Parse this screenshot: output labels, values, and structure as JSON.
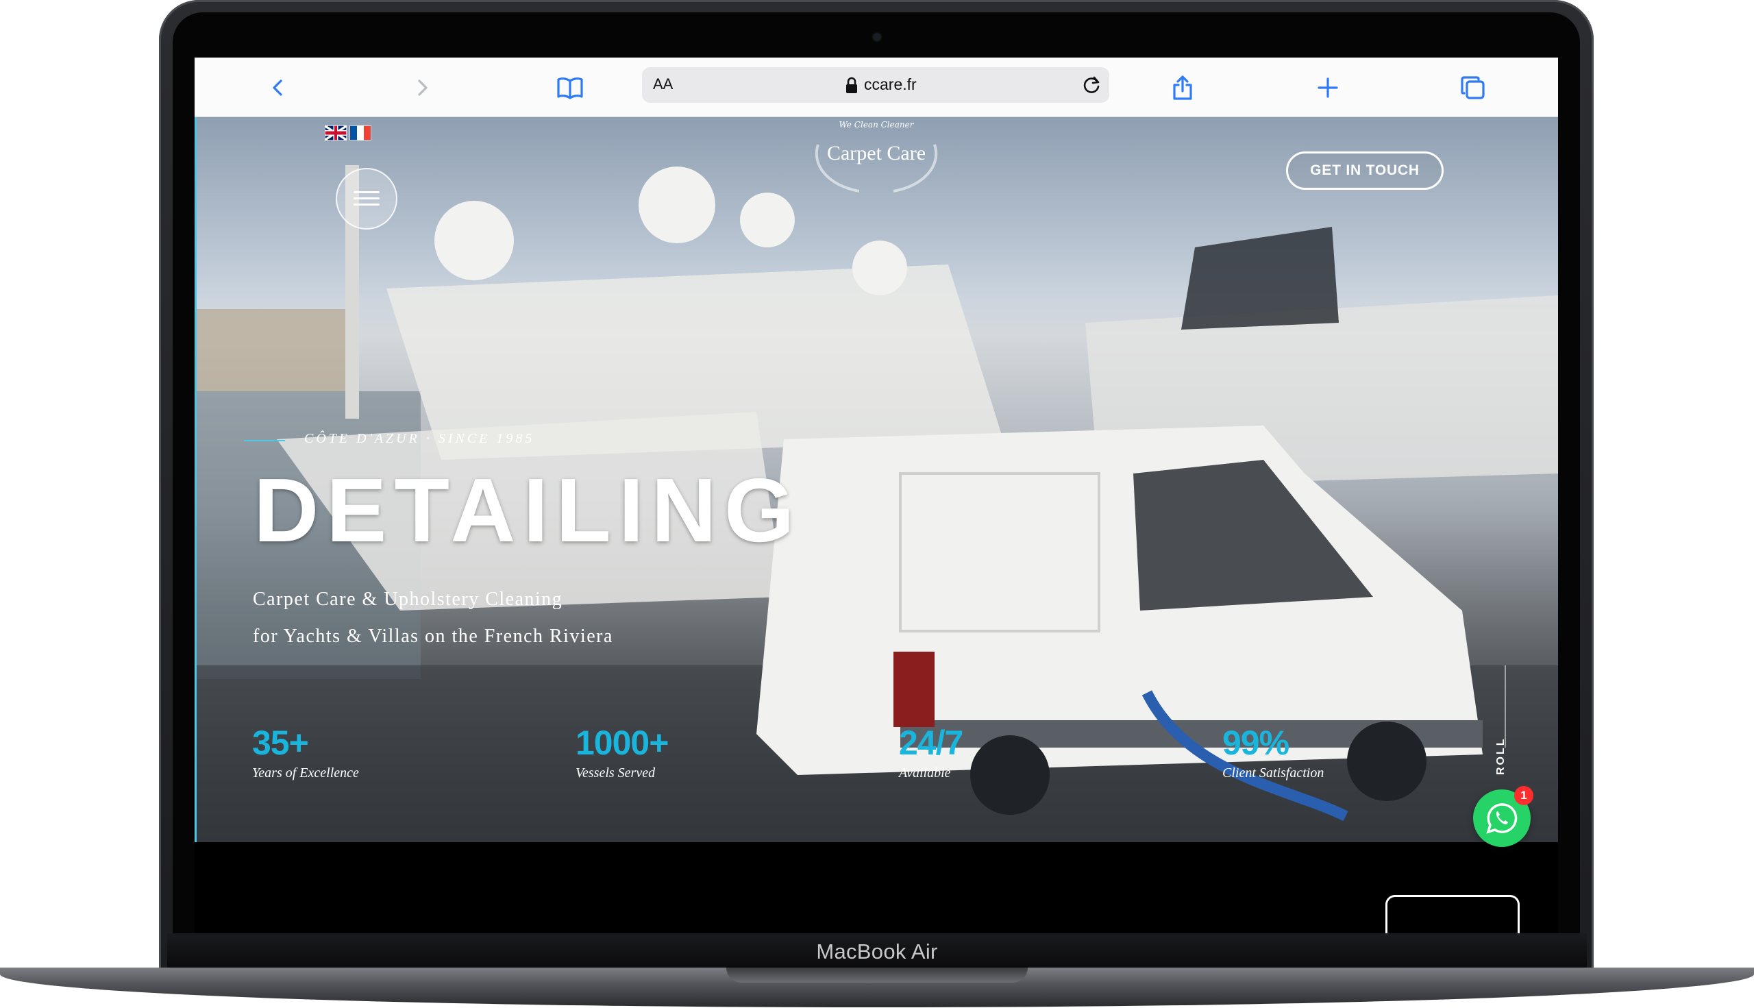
{
  "device": {
    "label": "MacBook Air"
  },
  "browser": {
    "url_aa": "AA",
    "url": "ccare.fr",
    "icons": [
      "back-icon",
      "forward-icon",
      "bookmarks-icon",
      "lock-icon",
      "reload-icon",
      "share-icon",
      "new-tab-icon",
      "tabs-icon"
    ]
  },
  "site": {
    "brand_tag": "We Clean Cleaner",
    "brand_name": "Carpet Care",
    "cta_label": "GET IN TOUCH",
    "languages": [
      "English",
      "Français"
    ],
    "eyebrow": "CÔTE D'AZUR · SINCE 1985",
    "headline": "DETAILING",
    "sub_line_1": "Carpet Care & Upholstery Cleaning",
    "sub_line_2": "for Yachts & Villas on the French Riviera",
    "stats": [
      {
        "value": "35+",
        "label": "Years of Excellence"
      },
      {
        "value": "1000+",
        "label": "Vessels Served"
      },
      {
        "value": "24/7",
        "label": "Available"
      },
      {
        "value": "99%",
        "label": "Client Satisfaction"
      }
    ],
    "scroll_text": "ROLL",
    "whatsapp_badge": "1"
  },
  "colors": {
    "accent": "#19b5dc",
    "whatsapp": "#25d366",
    "browser_tint": "#2f7bf6"
  }
}
